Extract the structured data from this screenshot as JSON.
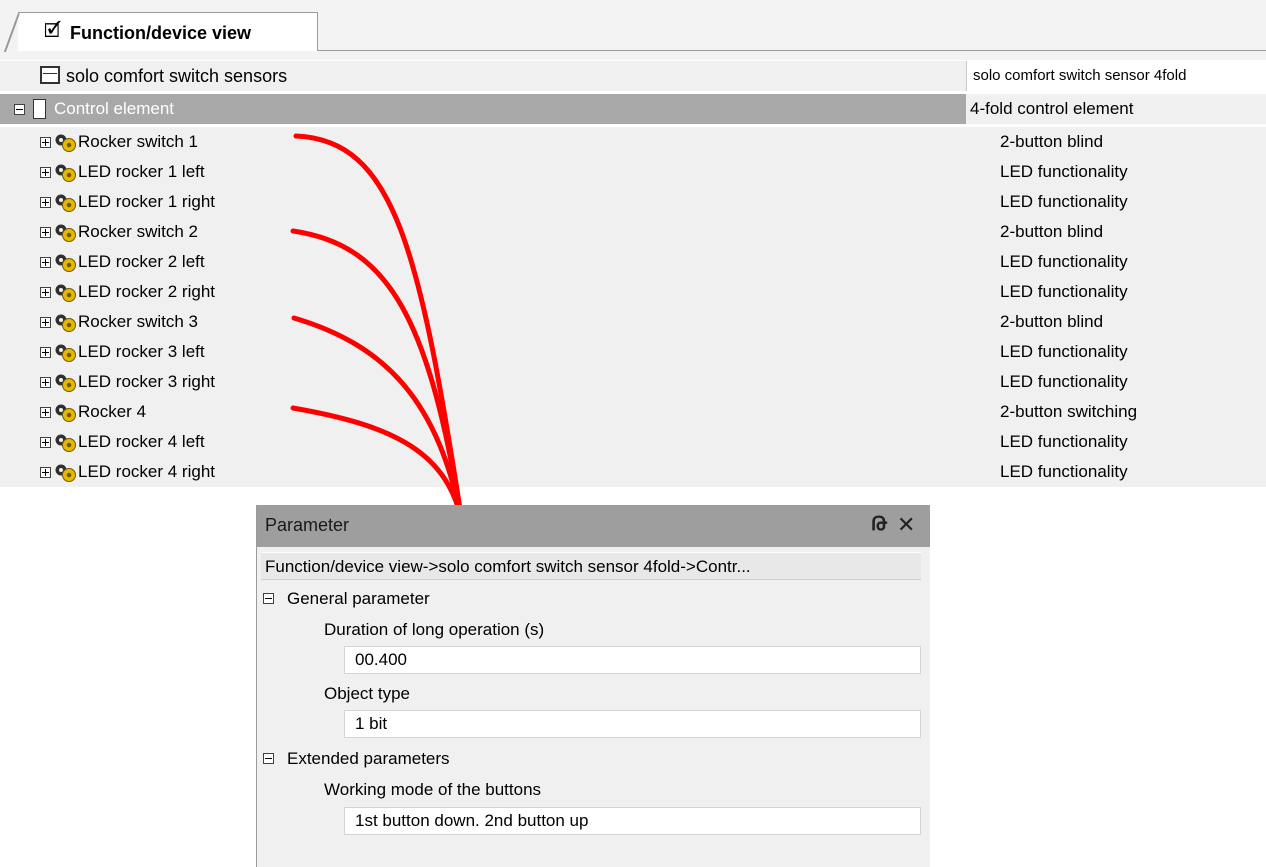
{
  "tab": {
    "label": "Function/device view",
    "icon": "checkbox-pin-icon"
  },
  "header_row": {
    "left": "solo comfort switch sensors",
    "right": "solo comfort switch sensor 4fold"
  },
  "control_row": {
    "left": "Control element",
    "right": "4-fold control element"
  },
  "items": [
    {
      "name": "Rocker switch 1",
      "function": "2-button blind"
    },
    {
      "name": "LED rocker 1 left",
      "function": "LED functionality"
    },
    {
      "name": "LED rocker 1 right",
      "function": "LED functionality"
    },
    {
      "name": "Rocker switch 2",
      "function": "2-button blind"
    },
    {
      "name": "LED rocker 2 left",
      "function": "LED functionality"
    },
    {
      "name": "LED rocker 2 right",
      "function": "LED functionality"
    },
    {
      "name": "Rocker switch 3",
      "function": "2-button blind"
    },
    {
      "name": "LED rocker 3 left",
      "function": "LED functionality"
    },
    {
      "name": "LED rocker 3 right",
      "function": "LED functionality"
    },
    {
      "name": "Rocker 4",
      "function": "2-button switching"
    },
    {
      "name": "LED rocker 4 left",
      "function": "LED functionality"
    },
    {
      "name": "LED rocker 4 right",
      "function": "LED functionality"
    }
  ],
  "panel": {
    "title": "Parameter",
    "pin_glyph": "Թ",
    "close_glyph": "✕",
    "breadcrumb": "Function/device view->solo comfort switch sensor 4fold->Contr...",
    "general_group": "General parameter",
    "long_op_label": "Duration of long operation (s)",
    "long_op_value": "00.400",
    "object_type_label": "Object type",
    "object_type_value": "1 bit",
    "extended_group": "Extended parameters",
    "working_mode_label": "Working mode of the buttons",
    "working_mode_value": "1st button down. 2nd button up"
  },
  "colors": {
    "arrow": "#ff0000",
    "selected_row": "#a8a8a8",
    "title_bar": "#9e9e9e"
  }
}
